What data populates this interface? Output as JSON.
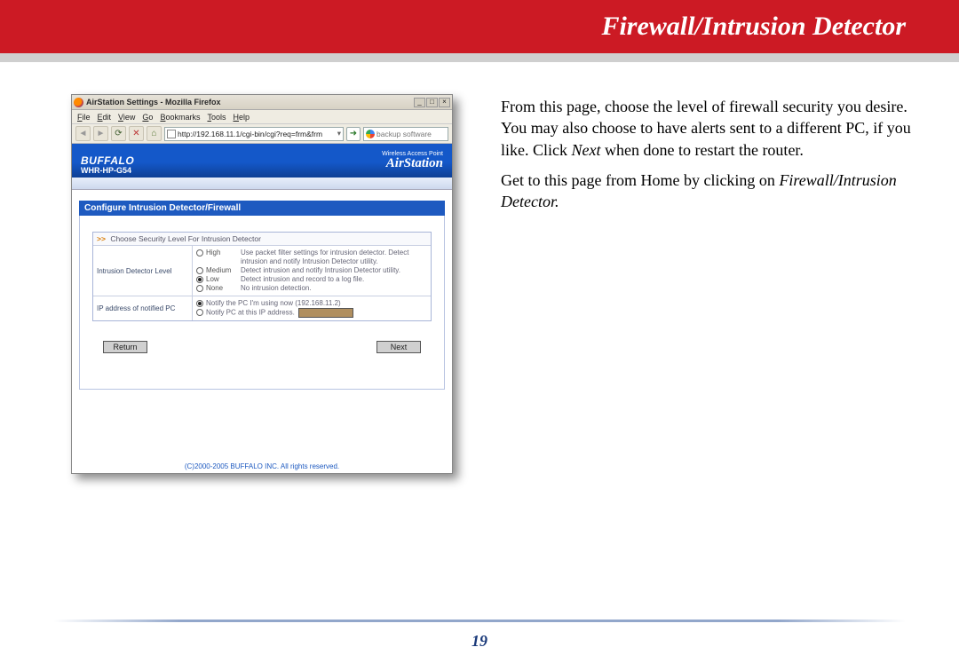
{
  "banner": {
    "title": "Firewall/Intrusion Detector"
  },
  "description": {
    "p1_a": "From this page, choose the level of firewall security you desire.    You may also choose to have alerts sent to a different PC, if you like.  Click ",
    "p1_next": "Next",
    "p1_b": " when done to restart the router.",
    "p2_a": "Get to this page from Home by clicking on ",
    "p2_link": "Firewall/Intrusion Detector."
  },
  "page_number": "19",
  "browser": {
    "window_title": "AirStation Settings - Mozilla Firefox",
    "menus": [
      "File",
      "Edit",
      "View",
      "Go",
      "Bookmarks",
      "Tools",
      "Help"
    ],
    "url": "http://192.168.11.1/cgi-bin/cgi?req=frm&frm",
    "search_placeholder": "backup software"
  },
  "router": {
    "brand": "BUFFALO",
    "model": "WHR-HP-G54",
    "wap_label": "Wireless Access Point",
    "airstation": "AirStation",
    "section_title": "Configure Intrusion Detector/Firewall",
    "level_caption": "Choose Security Level For Intrusion Detector",
    "row1_label": "Intrusion Detector Level",
    "levels": [
      {
        "label": "High",
        "desc": "Use packet filter settings for intrusion detector. Detect intrusion and notify Intrusion Detector utility.",
        "selected": false
      },
      {
        "label": "Medium",
        "desc": "Detect intrusion and notify Intrusion Detector utility.",
        "selected": false
      },
      {
        "label": "Low",
        "desc": "Detect intrusion and record to a log file.",
        "selected": true
      },
      {
        "label": "None",
        "desc": "No intrusion detection.",
        "selected": false
      }
    ],
    "row2_label": "IP address of notified PC",
    "notify_current": "Notify the PC I'm using now (192.168.11.2)",
    "notify_other": "Notify PC at this IP address.",
    "notify_selected": "current",
    "buttons": {
      "return": "Return",
      "next": "Next"
    },
    "copyright": "(C)2000-2005 BUFFALO INC. All rights reserved."
  }
}
